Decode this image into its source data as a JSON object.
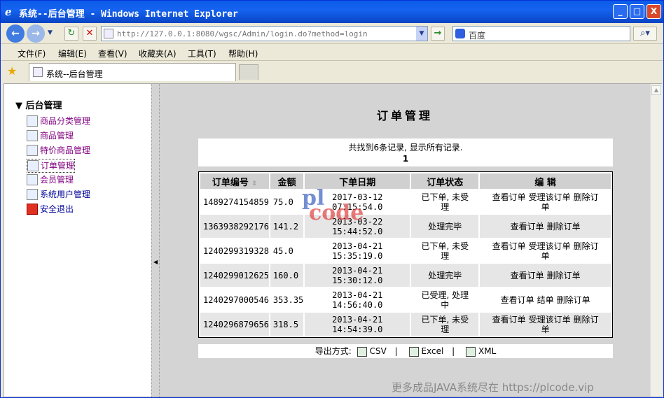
{
  "window": {
    "title": "系统--后台管理 - Windows Internet Explorer",
    "minimize": "_",
    "maximize": "□",
    "close": "X"
  },
  "nav": {
    "url": "http://127.0.0.1:8080/wgsc/Admin/login.do?method=login",
    "search_placeholder": "百度",
    "back": "←",
    "forward": "→",
    "refresh": "↻",
    "stop": "✕",
    "go": "→"
  },
  "menu": [
    "文件(F)",
    "编辑(E)",
    "查看(V)",
    "收藏夹(A)",
    "工具(T)",
    "帮助(H)"
  ],
  "tab": {
    "label": "系统--后台管理"
  },
  "sidebar": {
    "heading": "后台管理",
    "items": [
      {
        "label": "商品分类管理"
      },
      {
        "label": "商品管理"
      },
      {
        "label": "特价商品管理"
      },
      {
        "label": "订单管理"
      },
      {
        "label": "会员管理"
      },
      {
        "label": "系统用户管理"
      },
      {
        "label": "安全退出"
      }
    ]
  },
  "page": {
    "title": "订单管理",
    "count_text": "共找到6条记录, 显示所有记录.",
    "page_no": "1",
    "export_label": "导出方式:",
    "export_csv": "CSV",
    "export_excel": "Excel",
    "export_xml": "XML"
  },
  "table": {
    "headers": [
      "订单编号",
      "金额",
      "下单日期",
      "订单状态",
      "编 辑"
    ],
    "rows": [
      {
        "id": "1489274154859",
        "amount": "75.0",
        "date1": "2017-03-12",
        "date2": "07:15:54.0",
        "status1": "已下单, 未受",
        "status2": "理",
        "ops": [
          "查看订单",
          "受理该订单",
          "删除订"
        ],
        "ops2": "单"
      },
      {
        "id": "1363938292176",
        "amount": "141.2",
        "date1": "2013-03-22",
        "date2": "15:44:52.0",
        "status1": "处理完毕",
        "status2": "",
        "ops": [
          "查看订单",
          "删除订单"
        ],
        "ops2": ""
      },
      {
        "id": "1240299319328",
        "amount": "45.0",
        "date1": "2013-04-21",
        "date2": "15:35:19.0",
        "status1": "已下单, 未受",
        "status2": "理",
        "ops": [
          "查看订单",
          "受理该订单",
          "删除订"
        ],
        "ops2": "单"
      },
      {
        "id": "1240299012625",
        "amount": "160.0",
        "date1": "2013-04-21",
        "date2": "15:30:12.0",
        "status1": "处理完毕",
        "status2": "",
        "ops": [
          "查看订单",
          "删除订单"
        ],
        "ops2": ""
      },
      {
        "id": "1240297000546",
        "amount": "353.35",
        "date1": "2013-04-21",
        "date2": "14:56:40.0",
        "status1": "已受理, 处理",
        "status2": "中",
        "ops": [
          "查看订单",
          "结单",
          "删除订单"
        ],
        "ops2": ""
      },
      {
        "id": "1240296879656",
        "amount": "318.5",
        "date1": "2013-04-21",
        "date2": "14:54:39.0",
        "status1": "已下单, 未受",
        "status2": "理",
        "ops": [
          "查看订单",
          "受理该订单",
          "删除订"
        ],
        "ops2": "单"
      }
    ]
  },
  "watermark": {
    "logo_top": "pl",
    "logo_bottom": "code",
    "text": "更多成品JAVA系统尽在 https://plcode.vip"
  }
}
